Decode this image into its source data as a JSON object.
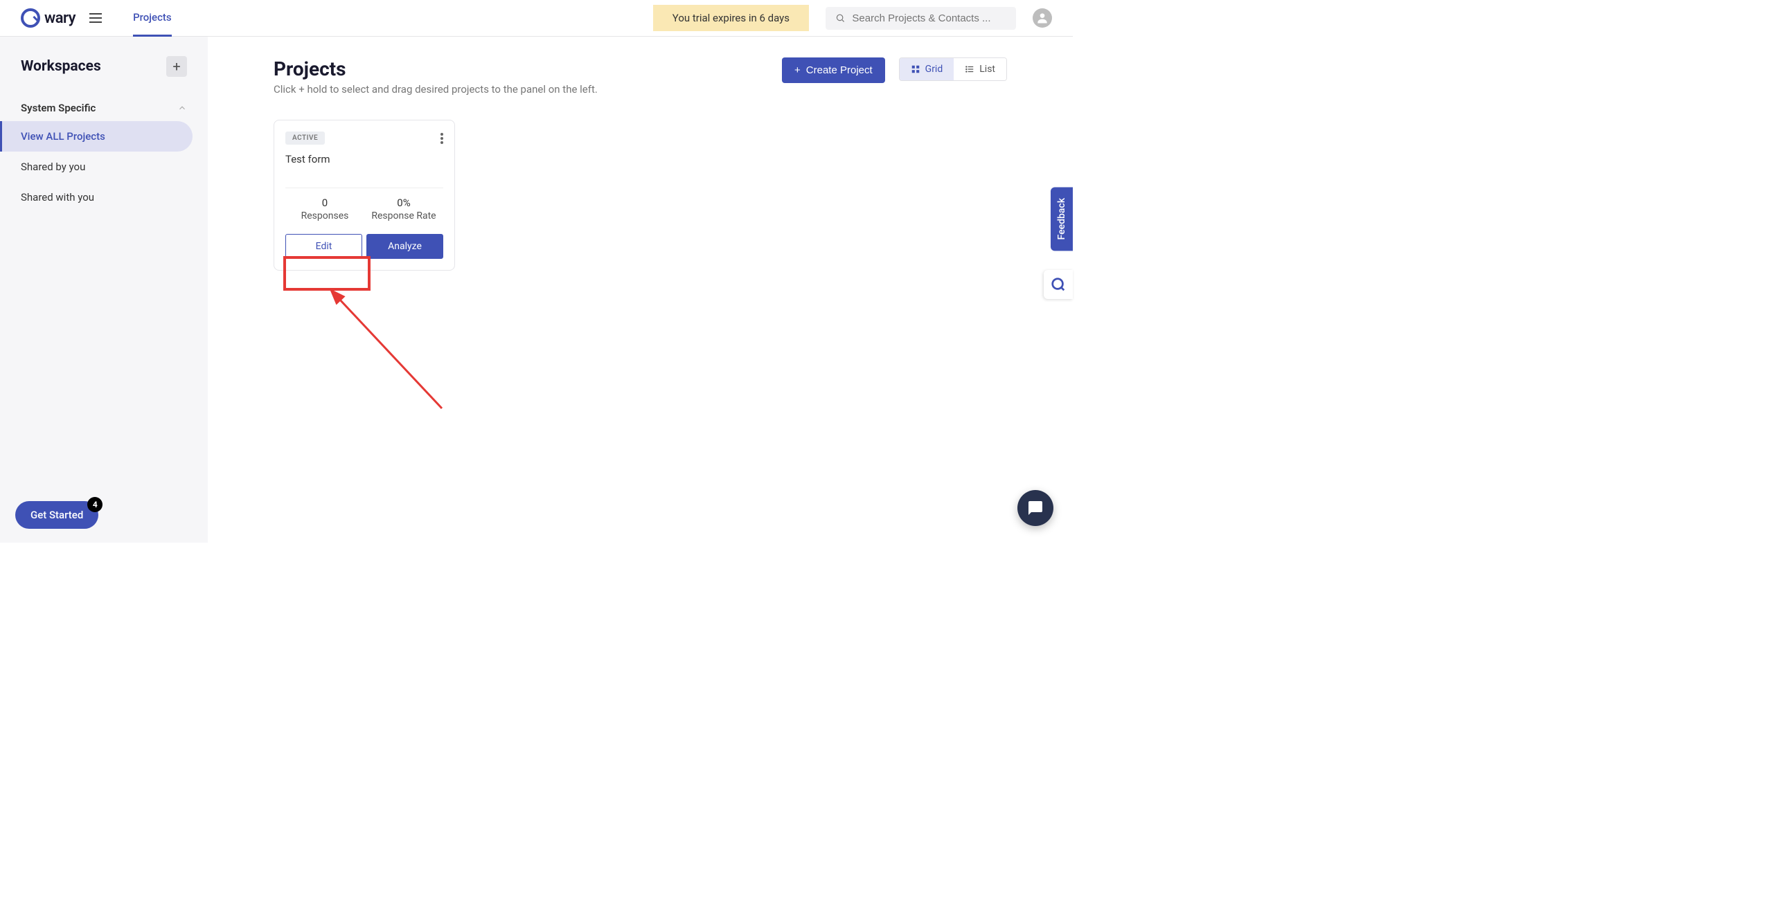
{
  "header": {
    "logo_text": "wary",
    "nav_tab": "Projects",
    "trial_text": "You trial expires in 6 days",
    "search_placeholder": "Search Projects & Contacts ..."
  },
  "sidebar": {
    "title": "Workspaces",
    "group": "System Specific",
    "items": [
      "View ALL Projects",
      "Shared by you",
      "Shared with you"
    ],
    "active_index": 0
  },
  "main": {
    "title": "Projects",
    "subtitle": "Click + hold to select and drag desired projects to the panel on the left.",
    "create_label": "Create Project",
    "view_grid": "Grid",
    "view_list": "List"
  },
  "card": {
    "status": "ACTIVE",
    "title": "Test form",
    "responses_value": "0",
    "responses_label": "Responses",
    "rate_value": "0%",
    "rate_label": "Response Rate",
    "edit_label": "Edit",
    "analyze_label": "Analyze"
  },
  "footer": {
    "get_started": "Get Started",
    "get_started_count": "4",
    "feedback": "Feedback"
  }
}
